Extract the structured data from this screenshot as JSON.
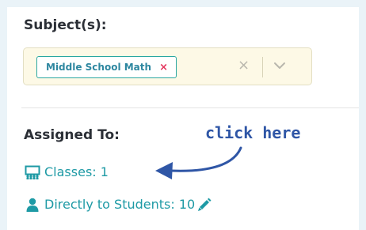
{
  "subjects": {
    "label": "Subject(s):",
    "selected_chip": "Middle School Math",
    "chip_remove_glyph": "×",
    "clear_glyph": "×",
    "dropdown_icon": "chevron-down-icon"
  },
  "assigned": {
    "label": "Assigned To:",
    "classes_link": "Classes: 1",
    "classes_icon": "classroom-icon",
    "students_link": "Directly to Students: 10",
    "students_icon": "person-icon",
    "edit_icon": "pencil-icon"
  },
  "annotation": {
    "text": "click here"
  },
  "colors": {
    "page_bg": "#eaf3f8",
    "select_bg": "#fdf9e6",
    "chip_border": "#2aa7a1",
    "chip_text": "#2e87a0",
    "remove_red": "#e3335b",
    "link_teal": "#1e9aa5",
    "annotation_blue": "#2f56a6"
  }
}
